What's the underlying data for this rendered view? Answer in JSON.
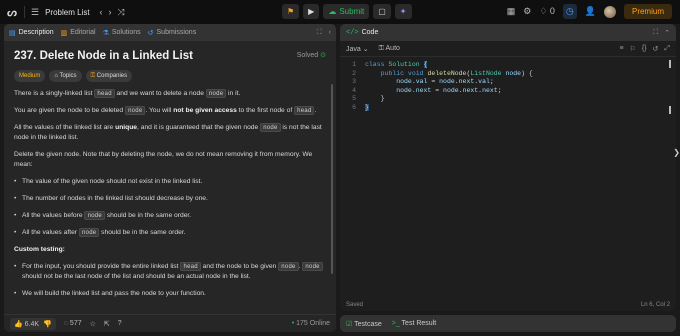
{
  "topbar": {
    "problem_list": "Problem List",
    "submit": "Submit",
    "streak": "0",
    "premium": "Premium"
  },
  "left_tabs": [
    "Description",
    "Editorial",
    "Solutions",
    "Submissions"
  ],
  "problem": {
    "title": "237. Delete Node in a Linked List",
    "solved": "Solved",
    "difficulty": "Medium",
    "topics": "Topics",
    "companies": "Companies"
  },
  "desc": {
    "p1a": "There is a singly-linked list ",
    "p1b": "head",
    "p1c": " and we want to delete a node ",
    "p1d": "node",
    "p1e": " in it.",
    "p2a": "You are given the node to be deleted ",
    "p2b": "node",
    "p2c": ". You will ",
    "p2d": "not be given access",
    "p2e": " to the first node of ",
    "p2f": "head",
    "p2g": ".",
    "p3a": "All the values of the linked list are ",
    "p3b": "unique",
    "p3c": ", and it is guaranteed that the given node ",
    "p3d": "node",
    "p3e": " is not the last node in the linked list.",
    "p4": "Delete the given node. Note that by deleting the node, we do not mean removing it from memory. We mean:",
    "b1": "The value of the given node should not exist in the linked list.",
    "b2": "The number of nodes in the linked list should decrease by one.",
    "b3a": "All the values before ",
    "b3b": "node",
    "b3c": " should be in the same order.",
    "b4a": "All the values after ",
    "b4b": "node",
    "b4c": " should be in the same order.",
    "custom": "Custom testing:",
    "c1a": "For the input, you should provide the entire linked list ",
    "c1b": "head",
    "c1c": " and the node to be given ",
    "c1d": "node",
    "c1e": ". ",
    "c1f": "node",
    "c1g": " should not be the last node of the list and should be an actual node in the list.",
    "c2": "We will build the linked list and pass the node to your function."
  },
  "bottom": {
    "likes": "6.4K",
    "comments": "577",
    "online": "175 Online"
  },
  "editor": {
    "tab": "Code",
    "language": "Java",
    "auto": "Auto",
    "saved": "Saved",
    "position": "Ln 6, Col 2"
  },
  "code_lines": [
    {
      "n": "1",
      "t": "class Solution {"
    },
    {
      "n": "2",
      "t": "    public void deleteNode(ListNode node) {"
    },
    {
      "n": "3",
      "t": "        node.val = node.next.val;"
    },
    {
      "n": "4",
      "t": "        node.next = node.next.next;"
    },
    {
      "n": "5",
      "t": "    }"
    },
    {
      "n": "6",
      "t": "}"
    }
  ],
  "test": {
    "testcase": "Testcase",
    "result": "Test Result"
  }
}
